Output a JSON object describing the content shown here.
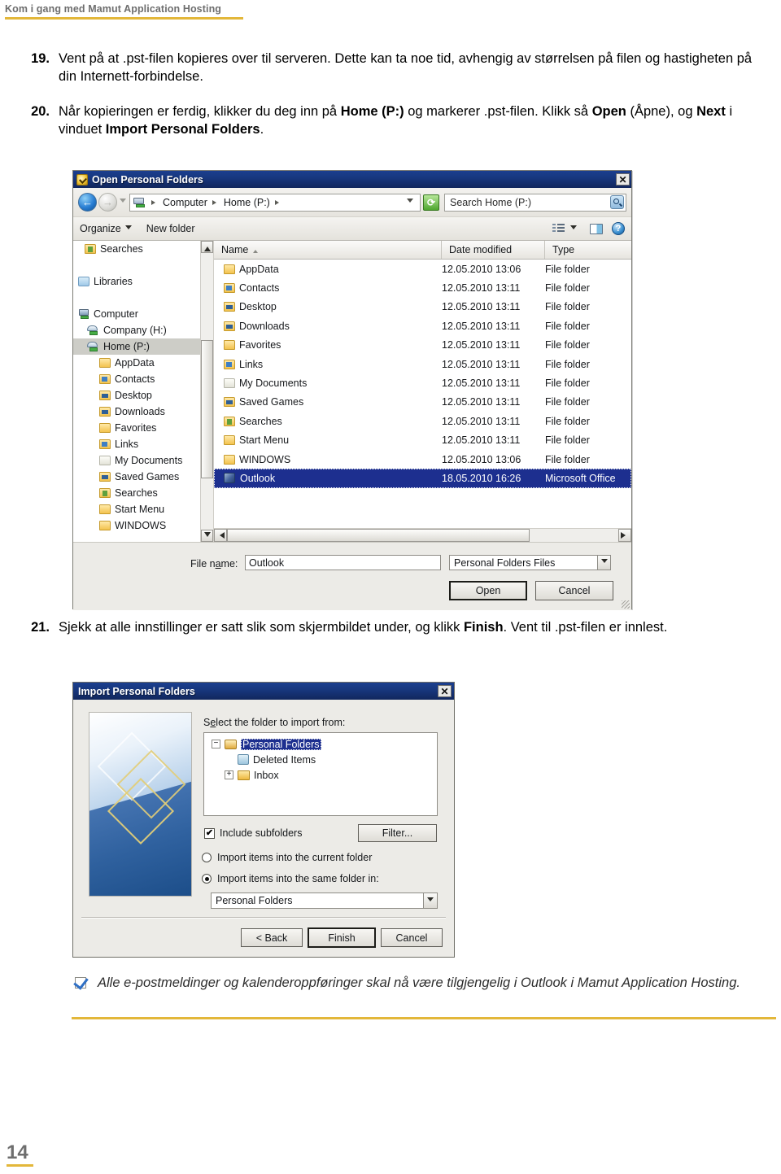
{
  "document": {
    "header_title": "Kom i gang med Mamut Application Hosting",
    "page_number": "14",
    "accent_gold": "#e3b73a",
    "header_gray": "#6e6e6e"
  },
  "steps": [
    {
      "number": "19.",
      "text_parts": [
        {
          "text": "Vent på at .pst-filen kopieres over til serveren. Dette kan ta noe tid, avhengig av størrelsen på filen og hastigheten på din Internett-forbindelse.",
          "bold": false
        }
      ],
      "plain": "Vent på at .pst-filen kopieres over til serveren. Dette kan ta noe tid, avhengig av størrelsen på filen og hastigheten på din Internett-forbindelse."
    },
    {
      "number": "20.",
      "plain": "Når kopieringen er ferdig, klikker du deg inn på Home (P:) og markerer .pst-filen. Klikk så Open (Åpne), og Next i vinduet Import Personal Folders.",
      "segments": [
        {
          "t": "Når kopieringen er ferdig, klikker du deg inn på ",
          "b": false
        },
        {
          "t": "Home (P:)",
          "b": true
        },
        {
          "t": " og markerer .pst-filen. Klikk så ",
          "b": false
        },
        {
          "t": "Open",
          "b": true
        },
        {
          "t": " (Åpne), og ",
          "b": false
        },
        {
          "t": "Next",
          "b": true
        },
        {
          "t": " i vinduet ",
          "b": false
        },
        {
          "t": "Import Personal Folders",
          "b": true
        },
        {
          "t": ".",
          "b": false
        }
      ]
    },
    {
      "number": "21.",
      "plain": "Sjekk at alle innstillinger er satt slik som skjermbildet under, og klikk Finish. Vent til .pst-filen er innlest.",
      "segments": [
        {
          "t": "Sjekk at alle innstillinger er satt slik som skjermbildet under, og klikk ",
          "b": false
        },
        {
          "t": "Finish",
          "b": true
        },
        {
          "t": ". Vent til .pst-filen er innlest.",
          "b": false
        }
      ]
    }
  ],
  "explorer_dialog": {
    "title": "Open Personal Folders",
    "title_icon": "folder-personal-icon",
    "close_label": "✕",
    "address": {
      "computer_label": "Computer",
      "drive_label": "Home (P:)",
      "computer_icon": "computer-icon"
    },
    "search": {
      "placeholder": "Search Home (P:)",
      "value": "Search Home (P:)",
      "icon": "search-icon"
    },
    "refresh_icon": "refresh-icon",
    "command_bar": {
      "organize_label": "Organize",
      "new_folder_label": "New folder",
      "view_icon": "list-view-icon",
      "pane_icon": "preview-pane-icon",
      "help_icon": "help-icon"
    },
    "tree": [
      {
        "label": "Searches",
        "indent": 1,
        "icon": "folder-search-icon",
        "selected": false
      },
      {
        "label": "",
        "indent": 0,
        "icon": "spacer",
        "selected": false
      },
      {
        "label": "Libraries",
        "indent": 0,
        "icon": "library-icon",
        "selected": false
      },
      {
        "label": "",
        "indent": 0,
        "icon": "spacer",
        "selected": false
      },
      {
        "label": "Computer",
        "indent": 0,
        "icon": "computer-icon",
        "selected": false
      },
      {
        "label": "Company (H:)",
        "indent": 1,
        "icon": "network-drive-icon",
        "selected": false
      },
      {
        "label": "Home (P:)",
        "indent": 1,
        "icon": "network-drive-icon",
        "selected": true
      },
      {
        "label": "AppData",
        "indent": 2,
        "icon": "folder-icon",
        "selected": false
      },
      {
        "label": "Contacts",
        "indent": 2,
        "icon": "folder-contacts-icon",
        "selected": false
      },
      {
        "label": "Desktop",
        "indent": 2,
        "icon": "folder-desktop-icon",
        "selected": false
      },
      {
        "label": "Downloads",
        "indent": 2,
        "icon": "folder-downloads-icon",
        "selected": false
      },
      {
        "label": "Favorites",
        "indent": 2,
        "icon": "folder-favorites-icon",
        "selected": false
      },
      {
        "label": "Links",
        "indent": 2,
        "icon": "folder-links-icon",
        "selected": false
      },
      {
        "label": "My Documents",
        "indent": 2,
        "icon": "folder-documents-icon",
        "selected": false
      },
      {
        "label": "Saved Games",
        "indent": 2,
        "icon": "folder-games-icon",
        "selected": false
      },
      {
        "label": "Searches",
        "indent": 2,
        "icon": "folder-search-icon",
        "selected": false
      },
      {
        "label": "Start Menu",
        "indent": 2,
        "icon": "folder-icon",
        "selected": false
      },
      {
        "label": "WINDOWS",
        "indent": 2,
        "icon": "folder-icon",
        "selected": false
      }
    ],
    "columns": [
      "Name",
      "Date modified",
      "Type"
    ],
    "sort_column": "Name",
    "sort_direction": "ascending",
    "files": [
      {
        "name": "AppData",
        "date": "12.05.2010 13:06",
        "type": "File folder",
        "icon": "folder-icon",
        "selected": false
      },
      {
        "name": "Contacts",
        "date": "12.05.2010 13:11",
        "type": "File folder",
        "icon": "folder-contacts-icon",
        "selected": false
      },
      {
        "name": "Desktop",
        "date": "12.05.2010 13:11",
        "type": "File folder",
        "icon": "folder-desktop-icon",
        "selected": false
      },
      {
        "name": "Downloads",
        "date": "12.05.2010 13:11",
        "type": "File folder",
        "icon": "folder-downloads-icon",
        "selected": false
      },
      {
        "name": "Favorites",
        "date": "12.05.2010 13:11",
        "type": "File folder",
        "icon": "folder-favorites-icon",
        "selected": false
      },
      {
        "name": "Links",
        "date": "12.05.2010 13:11",
        "type": "File folder",
        "icon": "folder-links-icon",
        "selected": false
      },
      {
        "name": "My Documents",
        "date": "12.05.2010 13:11",
        "type": "File folder",
        "icon": "folder-documents-icon",
        "selected": false
      },
      {
        "name": "Saved Games",
        "date": "12.05.2010 13:11",
        "type": "File folder",
        "icon": "folder-games-icon",
        "selected": false
      },
      {
        "name": "Searches",
        "date": "12.05.2010 13:11",
        "type": "File folder",
        "icon": "folder-search-icon",
        "selected": false
      },
      {
        "name": "Start Menu",
        "date": "12.05.2010 13:11",
        "type": "File folder",
        "icon": "folder-icon",
        "selected": false
      },
      {
        "name": "WINDOWS",
        "date": "12.05.2010 13:06",
        "type": "File folder",
        "icon": "folder-icon",
        "selected": false
      },
      {
        "name": "Outlook",
        "date": "18.05.2010 16:26",
        "type": "Microsoft Office",
        "icon": "outlook-pst-icon",
        "selected": true
      }
    ],
    "footer": {
      "file_name_label": "File name:",
      "file_name_value": "Outlook",
      "file_type_value": "Personal Folders Files",
      "open_label": "Open",
      "cancel_label": "Cancel"
    }
  },
  "import_dialog": {
    "title": "Import Personal Folders",
    "close_label": "✕",
    "select_label": "Select the folder to import from:",
    "tree": [
      {
        "label": "Personal Folders",
        "indent": 0,
        "expander": "−",
        "icon": "personal-folders-icon",
        "selected": true
      },
      {
        "label": "Deleted Items",
        "indent": 1,
        "expander": "",
        "icon": "deleted-items-icon",
        "selected": false
      },
      {
        "label": "Inbox",
        "indent": 0,
        "expander": "+",
        "icon": "inbox-folder-icon",
        "selected": false
      }
    ],
    "include_subfolders": {
      "label": "Include subfolders",
      "checked": true,
      "check_glyph": "✔"
    },
    "filter_label": "Filter...",
    "radio_current": {
      "label": "Import items into the current folder",
      "selected": false
    },
    "radio_same": {
      "label": "Import items into the same folder in:",
      "selected": true
    },
    "destination_value": "Personal Folders",
    "buttons": {
      "back": "< Back",
      "finish": "Finish",
      "cancel": "Cancel"
    },
    "default_button": "Finish"
  },
  "note": {
    "icon": "checkmark-icon",
    "text": "Alle e-postmeldinger og kalenderoppføringer skal nå være tilgjengelig i Outlook i Mamut Application Hosting."
  }
}
